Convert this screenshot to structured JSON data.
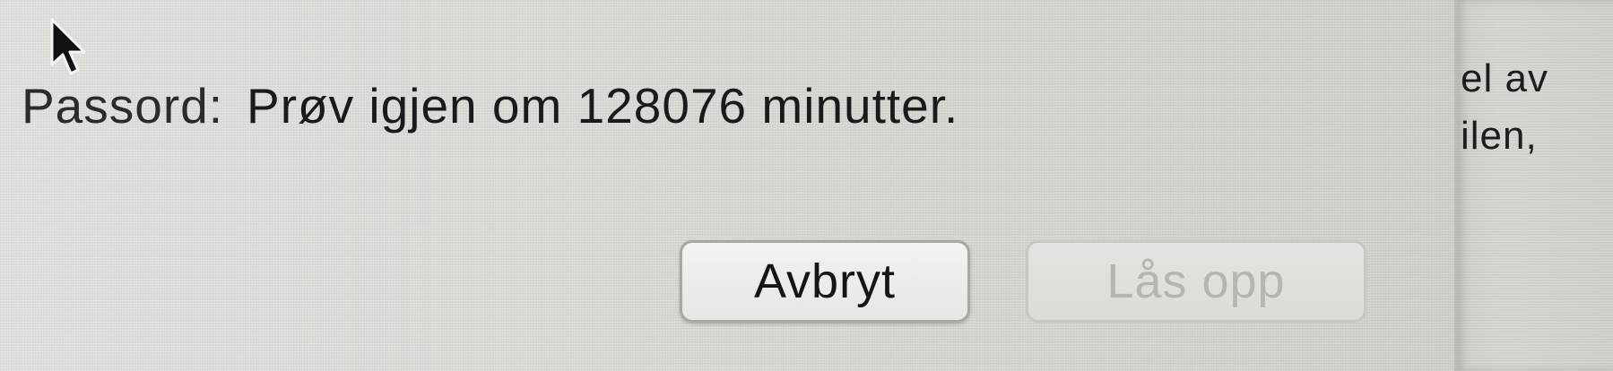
{
  "dialog": {
    "password_label": "Passord:",
    "message": "Prøv igjen om 128076 minutter.",
    "buttons": {
      "cancel": "Avbryt",
      "unlock": "Lås opp"
    }
  },
  "background_window": {
    "line1": "el av",
    "line2": "ilen,"
  },
  "icons": {
    "pointer": "arrow-cursor-icon"
  }
}
